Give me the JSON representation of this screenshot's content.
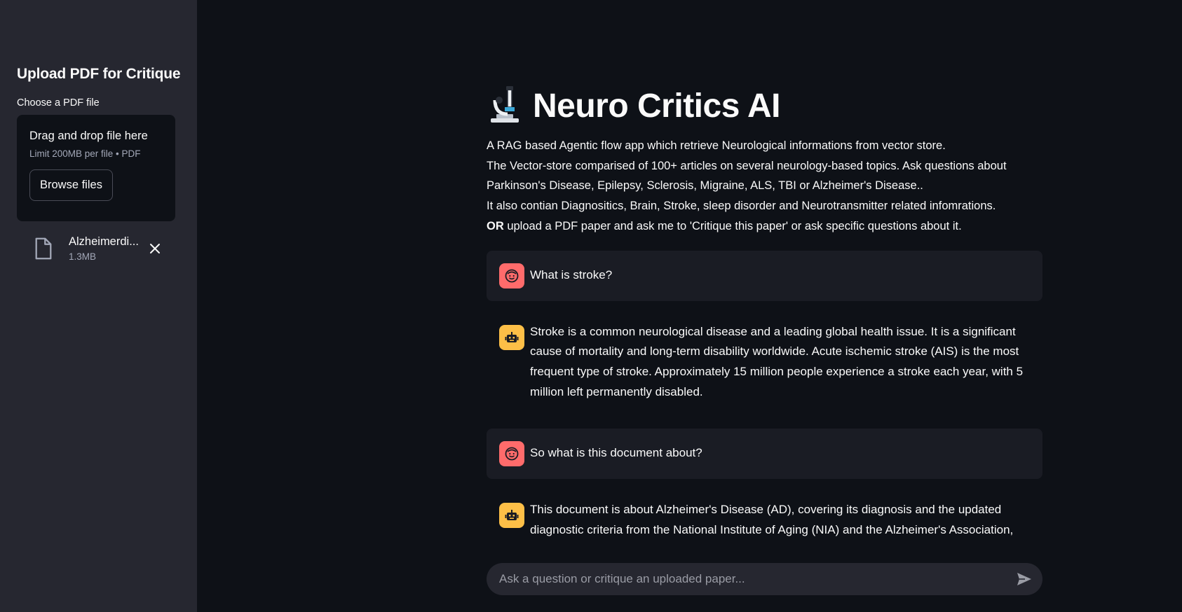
{
  "sidebar": {
    "title": "Upload PDF for Critique",
    "uploader_label": "Choose a PDF file",
    "dropzone_title": "Drag and drop file here",
    "dropzone_limit": "Limit 200MB per file • PDF",
    "browse_label": "Browse files",
    "file": {
      "name": "Alzheimerdi...",
      "size": "1.3MB",
      "icon": "file-icon"
    }
  },
  "header": {
    "title": "Neuro Critics AI",
    "icon": "microscope-icon"
  },
  "intro": {
    "line1": "A RAG based Agentic flow app which retrieve Neurological informations from vector store.",
    "line2": "The Vector-store comparised of 100+ articles on several neurology-based topics. Ask questions about Parkinson's Disease, Epilepsy, Sclerosis, Migraine, ALS, TBI or Alzheimer's Disease..",
    "line3": "It also contian Diagnositics, Brain, Stroke, sleep disorder and Neurotransmitter related infomrations.",
    "line4_bold": "OR",
    "line4_rest": " upload a PDF paper and ask me to 'Critique this paper' or ask specific questions about it."
  },
  "messages": [
    {
      "role": "user",
      "text": "What is stroke?"
    },
    {
      "role": "assistant",
      "text": "Stroke is a common neurological disease and a leading global health issue. It is a significant cause of mortality and long-term disability worldwide. Acute ischemic stroke (AIS) is the most frequent type of stroke. Approximately 15 million people experience a stroke each year, with 5 million left permanently disabled."
    },
    {
      "role": "user",
      "text": "So what is this document about?"
    },
    {
      "role": "assistant",
      "text": "This document is about Alzheimer's Disease (AD), covering its diagnosis and the updated diagnostic criteria from the National Institute of Aging (NIA) and the Alzheimer's Association,"
    }
  ],
  "chat_input": {
    "placeholder": "Ask a question or critique an uploaded paper..."
  },
  "colors": {
    "background": "#0e1117",
    "sidebar": "#262730",
    "user_avatar": "#ff6b6b",
    "bot_avatar": "#fdbf47"
  }
}
